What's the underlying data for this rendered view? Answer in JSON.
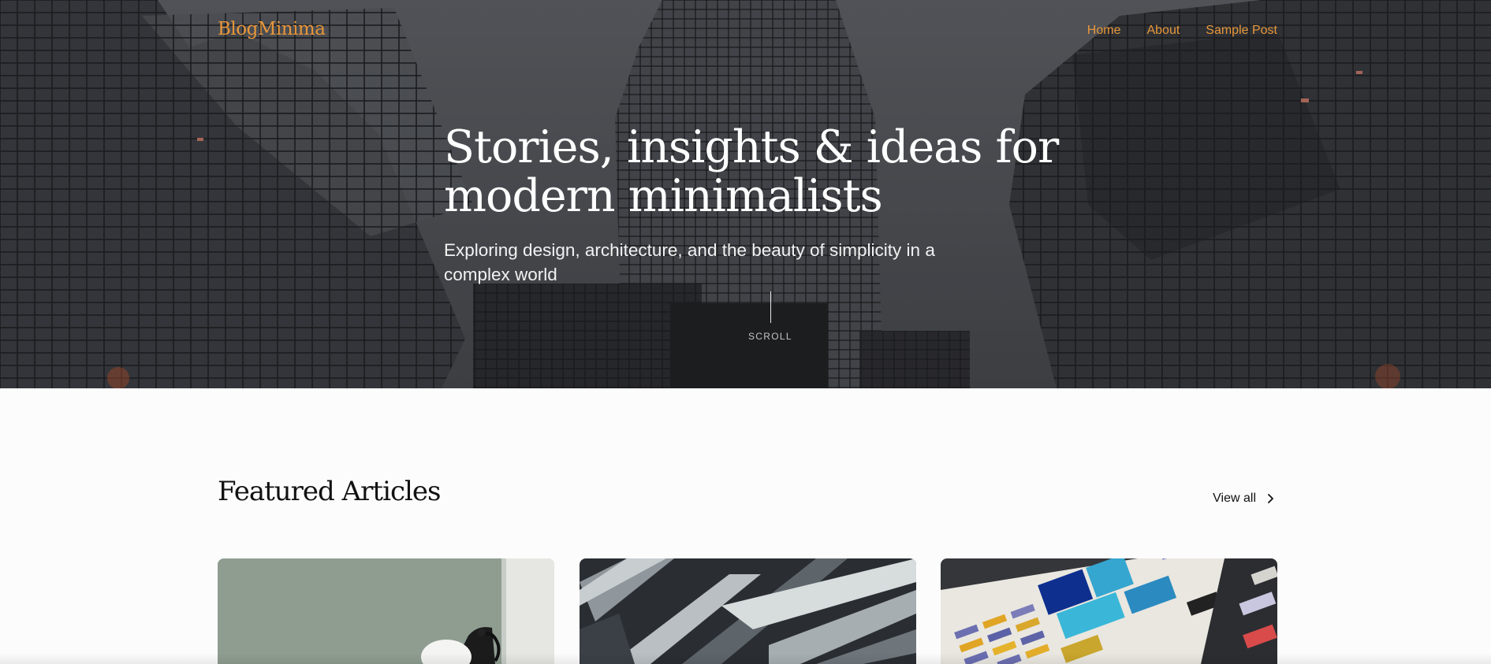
{
  "nav": {
    "logo": "BlogMinima",
    "links": [
      {
        "label": "Home"
      },
      {
        "label": "About"
      },
      {
        "label": "Sample Post"
      }
    ]
  },
  "hero": {
    "title": "Stories, insights & ideas for modern minimalists",
    "subtitle": "Exploring design, architecture, and the beauty of simplicity in a complex world",
    "scroll_label": "SCROLL"
  },
  "featured": {
    "title": "Featured Articles",
    "view_all_label": "View all",
    "cards": [
      {
        "image": "desk-lamp-photo"
      },
      {
        "image": "architecture-facade-photo"
      },
      {
        "image": "color-swatches-photo"
      }
    ]
  },
  "colors": {
    "accent": "#e8973a",
    "text_dark": "#111111",
    "background": "#fcfcfc"
  }
}
